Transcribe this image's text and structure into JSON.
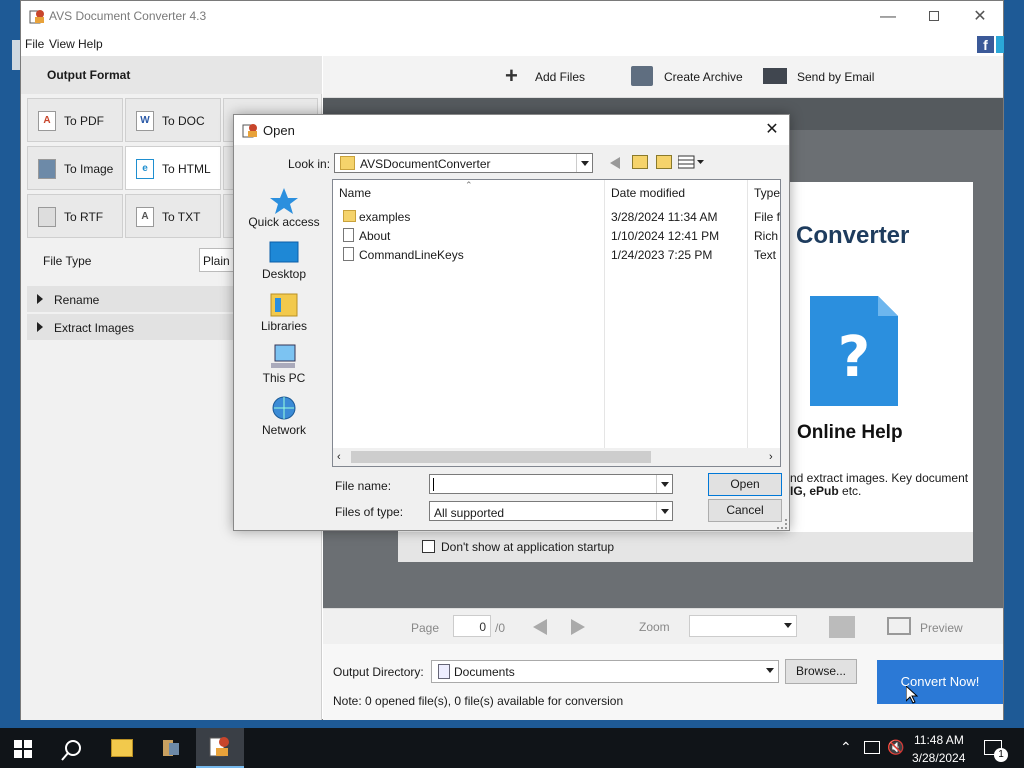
{
  "app": {
    "title": "AVS Document Converter 4.3",
    "menu": [
      "File",
      "View",
      "Help"
    ],
    "output_format_header": "Output Format",
    "formats": [
      {
        "label": "To PDF",
        "icon": "pdf-icon"
      },
      {
        "label": "To DOC",
        "icon": "doc-icon"
      },
      {
        "label": "To Image",
        "icon": "image-icon"
      },
      {
        "label": "To HTML",
        "icon": "html-icon",
        "selected": true
      },
      {
        "label": "To RTF",
        "icon": "rtf-icon"
      },
      {
        "label": "To TXT",
        "icon": "txt-icon"
      }
    ],
    "file_type_label": "File Type",
    "file_type_value": "Plain H",
    "sections": [
      "Rename",
      "Extract Images"
    ],
    "toolbar": {
      "add_files": "Add Files",
      "create_archive": "Create Archive",
      "send_email": "Send by Email"
    },
    "help": {
      "title": "Converter",
      "online_help": "Online Help",
      "desc_line1": "nd extract images. Key document",
      "desc_line2_bold": "IG, ePub",
      "desc_line2_tail": " etc.",
      "dont_show": "Don't show at application startup"
    },
    "pagebar": {
      "page_label": "Page",
      "page_value": "0",
      "page_total": "/0",
      "zoom_label": "Zoom",
      "preview_label": "Preview"
    },
    "output": {
      "dir_label": "Output Directory:",
      "dir_value": "Documents",
      "browse": "Browse...",
      "convert": "Convert Now!",
      "note": "Note: 0 opened file(s), 0 file(s) available for conversion"
    },
    "colors": {
      "accent": "#2b78d0",
      "convert_bg": "#2b79d6"
    }
  },
  "dialog": {
    "title": "Open",
    "look_in_label": "Look in:",
    "look_in_value": "AVSDocumentConverter",
    "places": [
      "Quick access",
      "Desktop",
      "Libraries",
      "This PC",
      "Network"
    ],
    "columns": {
      "name": "Name",
      "date": "Date modified",
      "type": "Type"
    },
    "files": [
      {
        "name": "examples",
        "date": "3/28/2024 11:34 AM",
        "type": "File fo",
        "icon": "folder-icon"
      },
      {
        "name": "About",
        "date": "1/10/2024 12:41 PM",
        "type": "Rich T",
        "icon": "rtf-file-icon"
      },
      {
        "name": "CommandLineKeys",
        "date": "1/24/2023 7:25 PM",
        "type": "Text D",
        "icon": "text-file-icon"
      }
    ],
    "file_name_label": "File name:",
    "file_name_value": "",
    "files_of_type_label": "Files of type:",
    "files_of_type_value": "All supported",
    "open_button": "Open",
    "cancel_button": "Cancel"
  },
  "taskbar": {
    "time": "11:48 AM",
    "date": "3/28/2024",
    "notification_count": "1"
  }
}
